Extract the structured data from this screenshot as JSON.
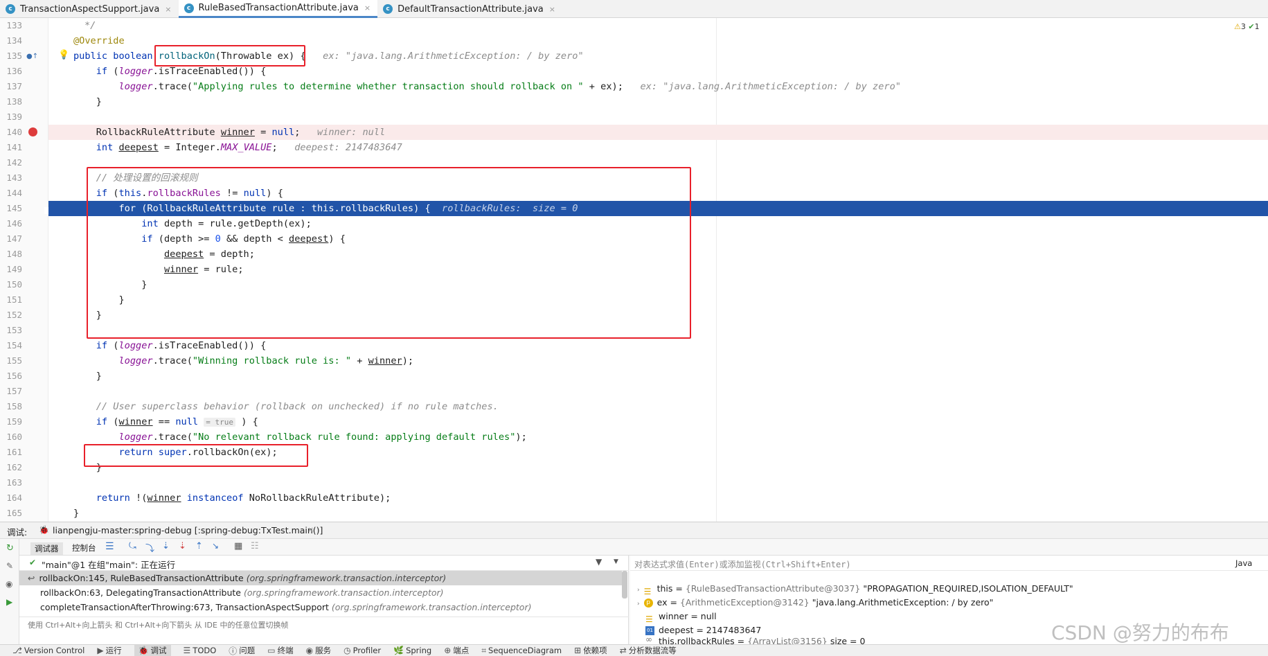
{
  "tabs": [
    {
      "label": "TransactionAspectSupport.java",
      "close": "×",
      "active": false
    },
    {
      "label": "RuleBasedTransactionAttribute.java",
      "close": "×",
      "active": true
    },
    {
      "label": "DefaultTransactionAttribute.java",
      "close": "×",
      "active": false
    }
  ],
  "inspections": {
    "warnings": "3",
    "checks": "1"
  },
  "line_numbers": [
    "133",
    "134",
    "135",
    "136",
    "137",
    "138",
    "139",
    "140",
    "141",
    "142",
    "143",
    "144",
    "145",
    "146",
    "147",
    "148",
    "149",
    "150",
    "151",
    "152",
    "153",
    "154",
    "155",
    "156",
    "157",
    "158",
    "159",
    "160",
    "161",
    "162",
    "163",
    "164",
    "165"
  ],
  "code": {
    "l133": "*/",
    "l134": "@Override",
    "l135": {
      "kw1": "public",
      "kw2": "boolean",
      "method": "rollbackOn",
      "params_a": "(Throwable ",
      "params_b": "ex",
      "params_c": ") {",
      "hint": "ex: \"java.lang.ArithmeticException: / by zero\""
    },
    "l136": {
      "kw": "if",
      "a": " (",
      "logger": "logger",
      ".b": ".isTraceEnabled()) {"
    },
    "l137": {
      "logger": "logger",
      "a": ".trace(",
      "s": "\"Applying rules to determine whether transaction should rollback on \"",
      "b": " + ",
      "ex": "ex",
      "c": ");",
      "hint": "ex: \"java.lang.ArithmeticException: / by zero\""
    },
    "l138": "}",
    "l140": {
      "a": "RollbackRuleAttribute ",
      "v": "winner",
      "b": " = ",
      "kw": "null",
      "c": ";",
      "hint": "winner: null"
    },
    "l141": {
      "kw": "int",
      "a": " ",
      "v": "deepest",
      "b": " = Integer.",
      "st": "MAX_VALUE",
      "c": ";",
      "hint": "deepest: 2147483647"
    },
    "l143": "// 处理设置的回滚规则",
    "l144": {
      "kw1": "if",
      "a": " (",
      "kw2": "this",
      ".": ".",
      "f": "rollbackRules",
      "b": " != ",
      "kw3": "null",
      "c": ") {"
    },
    "l145": {
      "kw": "for",
      "a": " (RollbackRuleAttribute rule : ",
      "kw2": "this",
      "b": ".rollbackRules) {",
      "hint": "rollbackRules:  size = 0"
    },
    "l146": {
      "kw": "int",
      "a": " depth = rule.getDepth(",
      "ex": "ex",
      "b": ");"
    },
    "l147": {
      "kw": "if",
      "a": " (depth >= ",
      "n": "0",
      "b": " && depth < ",
      "v": "deepest",
      "c": ") {"
    },
    "l148": {
      "v": "deepest",
      "a": " = depth;"
    },
    "l149": {
      "v": "winner",
      "a": " = rule;"
    },
    "l150": "}",
    "l151": "}",
    "l152": "}",
    "l154": {
      "kw": "if",
      "a": " (",
      "logger": "logger",
      "b": ".isTraceEnabled()) {"
    },
    "l155": {
      "logger": "logger",
      "a": ".trace(",
      "s": "\"Winning rollback rule is: \"",
      "b": " + ",
      "v": "winner",
      "c": ");"
    },
    "l156": "}",
    "l158": "// User superclass behavior (rollback on unchecked) if no rule matches.",
    "l159": {
      "kw": "if",
      "a": " (",
      "v": "winner",
      "b": " == ",
      "kw2": "null",
      "inl": "= true",
      "c": " ) {"
    },
    "l160": {
      "logger": "logger",
      "a": ".trace(",
      "s": "\"No relevant rollback rule found: applying default rules\"",
      "b": ");"
    },
    "l161": {
      "kw": "return",
      "a": " ",
      "kw2": "super",
      "b": ".rollbackOn(",
      "ex": "ex",
      "c": ");"
    },
    "l162": "}",
    "l164": {
      "kw": "return",
      "a": " !(",
      "v": "winner",
      "b": " ",
      "kw2": "instanceof",
      "c": " NoRollbackRuleAttribute);"
    },
    "l165": "}"
  },
  "debug": {
    "label": "调试:",
    "session": "lianpengju-master:spring-debug [:spring-debug:TxTest.main()]",
    "session_close": "×",
    "tab_debugger": "调试器",
    "tab_console": "控制台",
    "thread": "\"main\"@1 在组\"main\": 正在运行",
    "frames": [
      {
        "method": "rollbackOn:145, RuleBasedTransactionAttribute",
        "pkg": "(org.springframework.transaction.interceptor)"
      },
      {
        "method": "rollbackOn:63, DelegatingTransactionAttribute",
        "pkg": "(org.springframework.transaction.interceptor)"
      },
      {
        "method": "completeTransactionAfterThrowing:673, TransactionAspectSupport",
        "pkg": "(org.springframework.transaction.interceptor)"
      }
    ],
    "hint": "使用 Ctrl+Alt+向上箭头 和 Ctrl+Alt+向下箭头 从 IDE 中的任意位置切换帧",
    "eval_placeholder": "对表达式求值(Enter)或添加监视(Ctrl+Shift+Enter)",
    "lang": "Java",
    "vars": [
      {
        "name": "this",
        "eq": " = ",
        "type": "{RuleBasedTransactionAttribute@3037}",
        "val": " \"PROPAGATION_REQUIRED,ISOLATION_DEFAULT\""
      },
      {
        "name": "ex",
        "eq": " = ",
        "type": "{ArithmeticException@3142}",
        "val": " \"java.lang.ArithmeticException: / by zero\""
      },
      {
        "name": "winner",
        "eq": " = ",
        "type": "",
        "val": "null"
      },
      {
        "name": "deepest",
        "eq": " = ",
        "type": "",
        "val": "2147483647"
      },
      {
        "name": "this.rollbackRules",
        "eq": " = ",
        "type": "{ArrayList@3156}",
        "val": "  size = 0"
      }
    ]
  },
  "statusbar": [
    "Version Control",
    "运行",
    "调试",
    "TODO",
    "问题",
    "终端",
    "服务",
    "Profiler",
    "Spring",
    "端点",
    "SequenceDiagram",
    "依赖项",
    "分析数据流等"
  ],
  "watermark": "CSDN @努力的布布",
  "colors": {
    "selection": "#2154a8",
    "redbox": "#e8202a",
    "keyword": "#0033b3",
    "string": "#067d17",
    "field": "#871094"
  }
}
